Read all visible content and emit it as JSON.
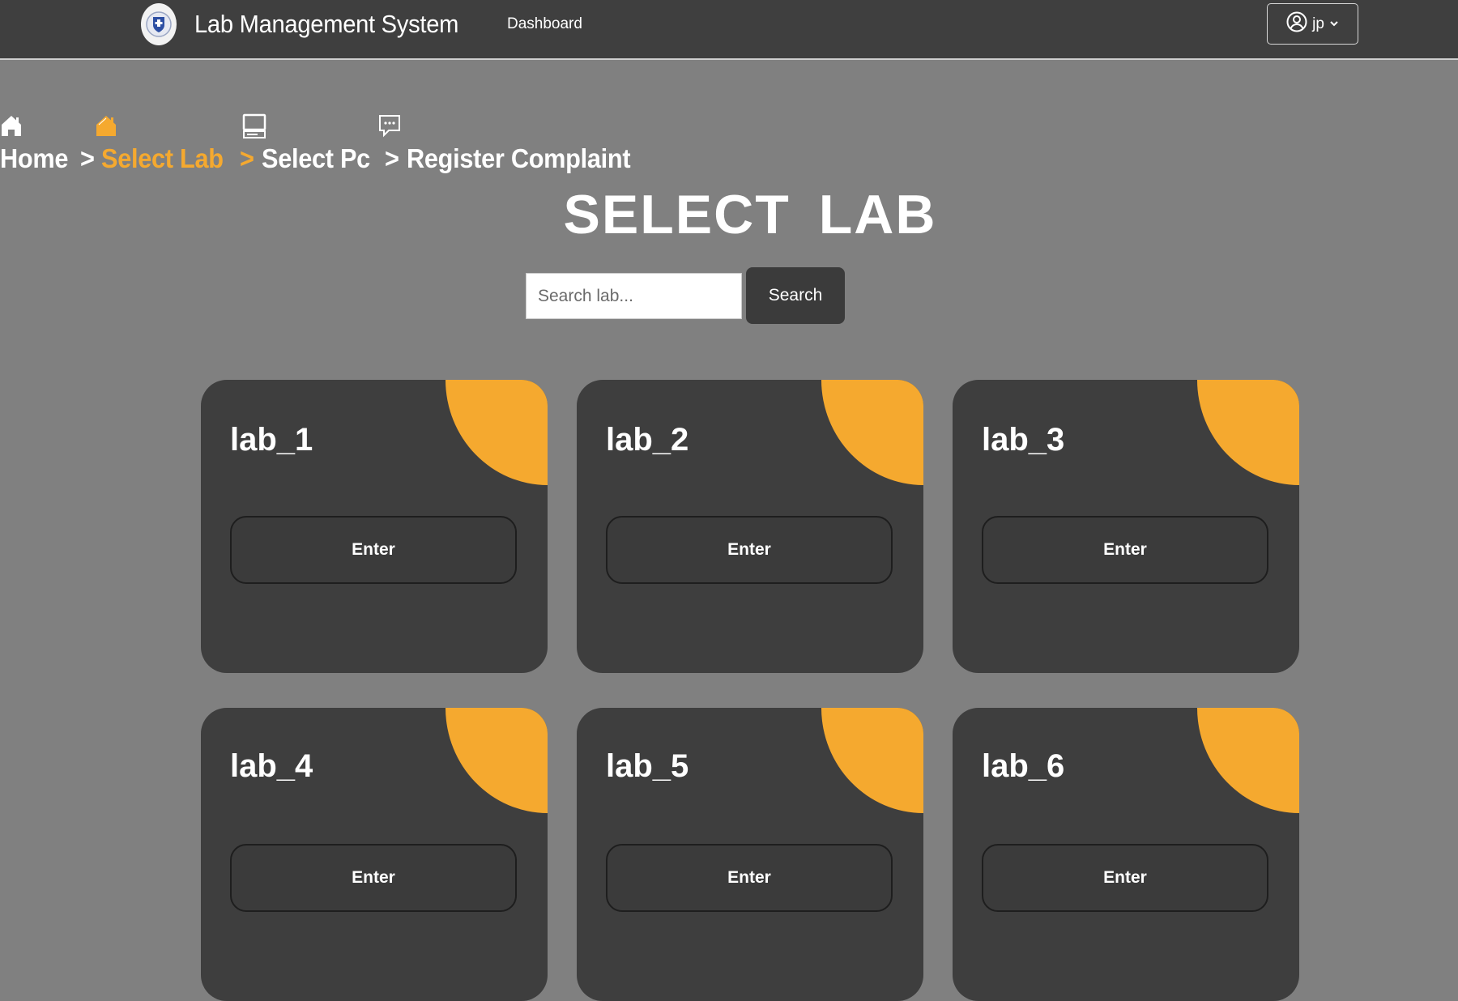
{
  "navbar": {
    "logo_icon": "institution-crest-icon",
    "title": "Lab Management System",
    "links": [
      {
        "label": "Dashboard"
      }
    ],
    "user": {
      "name": "jp",
      "icon": "user-circle-icon",
      "caret": "chevron-down-icon"
    }
  },
  "breadcrumb": {
    "items": [
      {
        "label": "Home",
        "icon": "home-icon"
      },
      {
        "label": "Select Lab",
        "icon": "home-outline-icon",
        "active": true
      },
      {
        "label": "Select Pc",
        "icon": "computer-icon"
      },
      {
        "label": "Register Complaint",
        "icon": "chat-icon"
      }
    ],
    "separator": ">"
  },
  "page": {
    "title": "SELECT LAB"
  },
  "search": {
    "placeholder": "Search lab...",
    "value": "",
    "button_label": "Search"
  },
  "labs": [
    {
      "name": "lab_1",
      "button": "Enter"
    },
    {
      "name": "lab_2",
      "button": "Enter"
    },
    {
      "name": "lab_3",
      "button": "Enter"
    },
    {
      "name": "lab_4",
      "button": "Enter"
    },
    {
      "name": "lab_5",
      "button": "Enter"
    },
    {
      "name": "lab_6",
      "button": "Enter"
    }
  ],
  "colors": {
    "background": "#808080",
    "navbar": "#3f3f3f",
    "card": "#3e3e3e",
    "accent": "#f5a92f",
    "text": "#ffffff"
  }
}
